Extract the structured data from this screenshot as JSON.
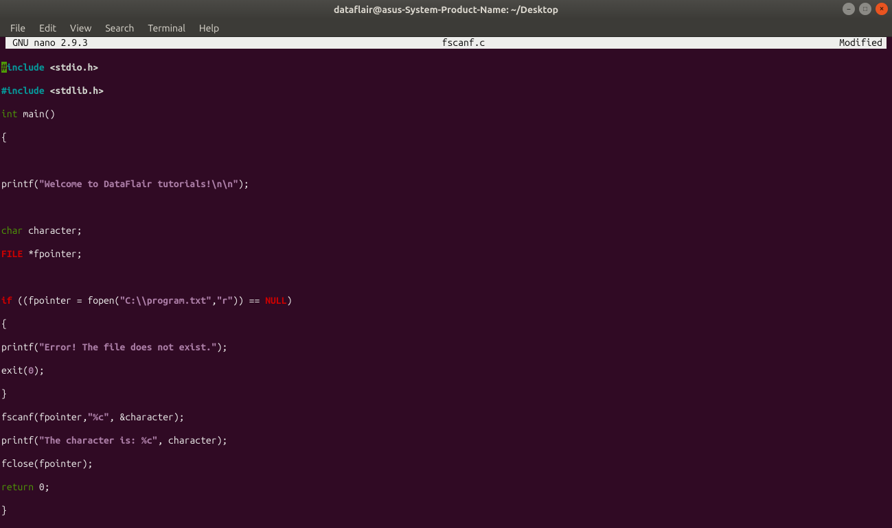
{
  "window": {
    "title": "dataflair@asus-System-Product-Name: ~/Desktop",
    "min_tip": "–",
    "max_tip": "□",
    "close_tip": "×"
  },
  "menubar": {
    "file": "File",
    "edit": "Edit",
    "view": "View",
    "search": "Search",
    "terminal": "Terminal",
    "help": "Help"
  },
  "status": {
    "left": "GNU nano 2.9.3",
    "center": "fscanf.c",
    "right": "Modified"
  },
  "code": {
    "l1_hash": "#",
    "l1_inc": "include ",
    "l1_hdr": "<stdio.h>",
    "l2_inc": "#include ",
    "l2_hdr": "<stdlib.h>",
    "l3_type": "int",
    "l3_rest": " main()",
    "l4": "{",
    "l6_a": "printf(",
    "l6_str": "\"Welcome to DataFlair tutorials!\\n\\n\"",
    "l6_b": ");",
    "l8_type": "char",
    "l8_rest": " character;",
    "l9_type": "FILE",
    "l9_rest": " *fpointer;",
    "l11_if": "if",
    "l11_a": " ((fpointer = fopen(",
    "l11_s1": "\"C:\\\\program.txt\"",
    "l11_c": ",",
    "l11_s2": "\"r\"",
    "l11_b": ")) == ",
    "l11_null": "NULL",
    "l11_end": ")",
    "l12": "{",
    "l13_a": "printf(",
    "l13_str": "\"Error! The file does not exist.\"",
    "l13_b": ");",
    "l14_a": "exit(",
    "l14_n": "0",
    "l14_b": ");",
    "l15": "}",
    "l16_a": "fscanf(fpointer,",
    "l16_str": "\"%c\"",
    "l16_b": ", &character);",
    "l17_a": "printf(",
    "l17_str": "\"The character is: %c\"",
    "l17_b": ", character);",
    "l18": "fclose(fpointer);",
    "l19_ret": "return",
    "l19_rest": " 0;",
    "l20": "}"
  }
}
